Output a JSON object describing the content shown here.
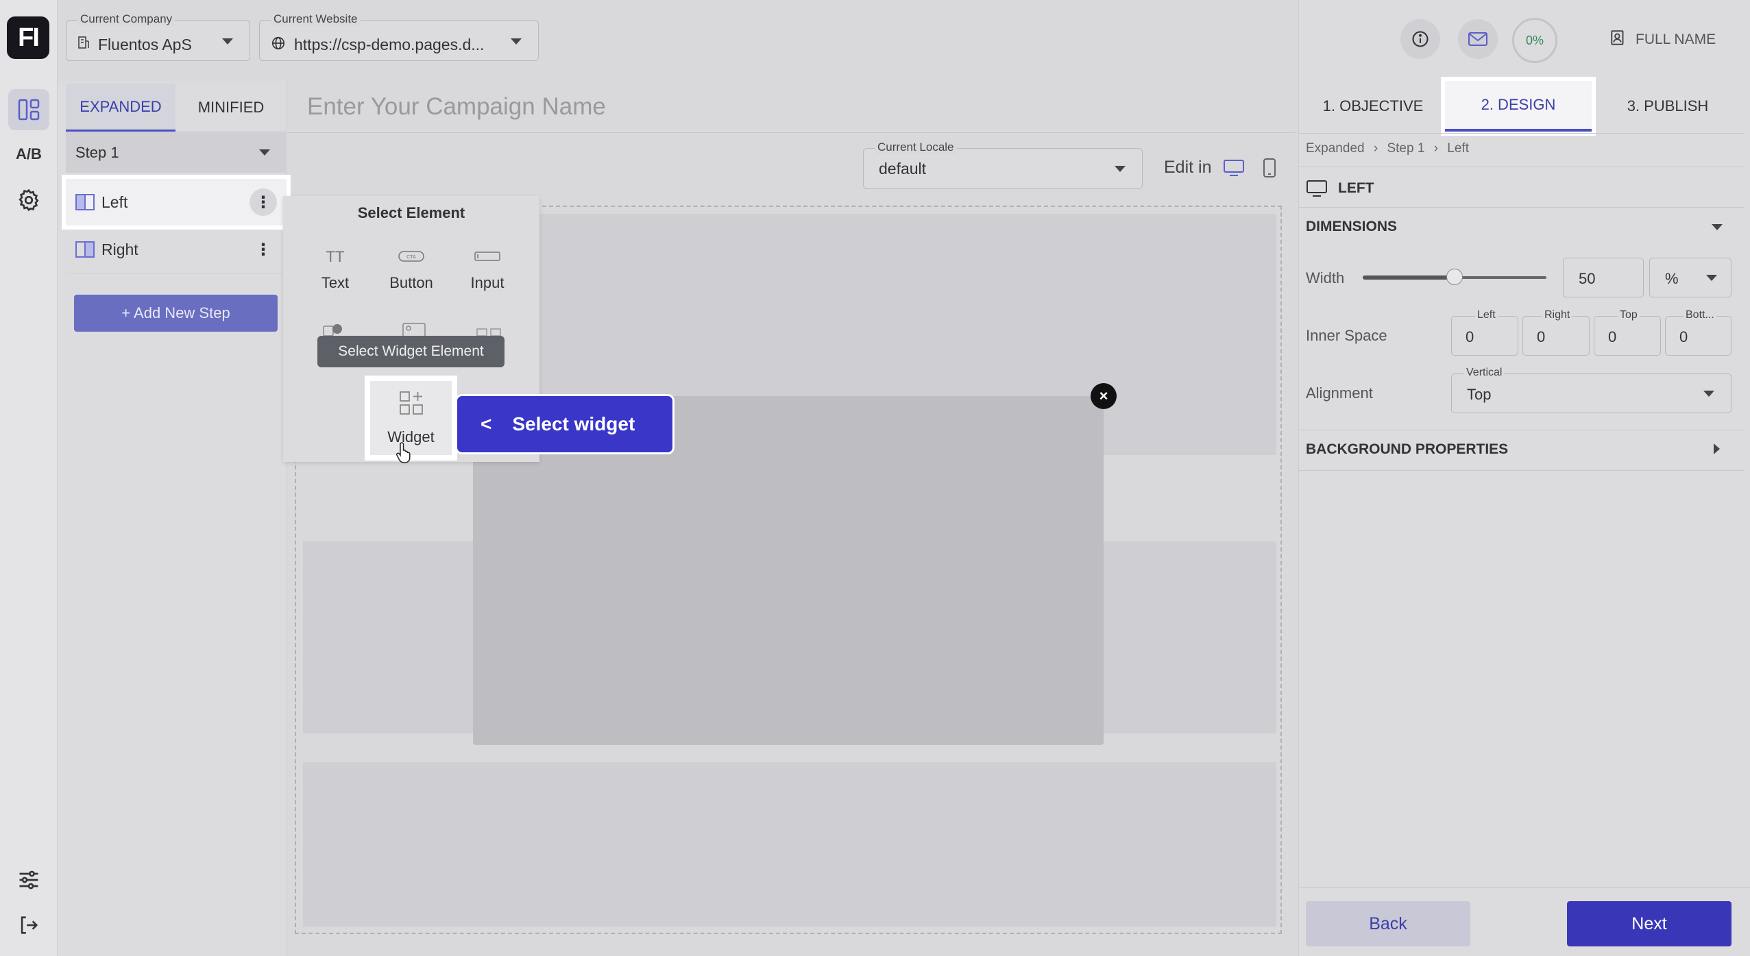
{
  "app": {
    "logo_text": "FI"
  },
  "rail": {
    "items": [
      {
        "icon": "layout-icon",
        "active": true
      },
      {
        "label": "A/B",
        "icon": "ab-test-icon"
      },
      {
        "icon": "gear-icon"
      },
      {
        "icon": "sliders-icon"
      },
      {
        "icon": "logout-icon"
      }
    ]
  },
  "header": {
    "company": {
      "label": "Current Company",
      "value": "Fluentos ApS"
    },
    "website": {
      "label": "Current Website",
      "value": "https://csp-demo.pages.d..."
    },
    "progress": "0%",
    "user_name": "FULL NAME"
  },
  "steps": {
    "tabs": [
      {
        "label": "EXPANDED",
        "active": true
      },
      {
        "label": "MINIFIED",
        "active": false
      }
    ],
    "selected_step": "Step 1",
    "items": [
      {
        "label": "Left",
        "highlighted": true
      },
      {
        "label": "Right",
        "highlighted": false
      }
    ],
    "add_label": "+ Add New Step"
  },
  "campaign": {
    "placeholder": "Enter Your Campaign Name"
  },
  "locale": {
    "label": "Current Locale",
    "value": "default",
    "edit_in": "Edit in"
  },
  "select_element": {
    "title": "Select Element",
    "items": [
      {
        "label": "Text",
        "icon": "text-icon"
      },
      {
        "label": "Button",
        "icon": "cta-button-icon"
      },
      {
        "label": "Input",
        "icon": "input-icon"
      }
    ],
    "tooltip": "Select Widget Element",
    "widget_label": "Widget",
    "callout": "Select widget",
    "callout_prefix": "<",
    "close": "×"
  },
  "design_panel": {
    "tabs": [
      {
        "label": "1. OBJECTIVE",
        "active": false
      },
      {
        "label": "2. DESIGN",
        "active": true
      },
      {
        "label": "3. PUBLISH",
        "active": false
      }
    ],
    "breadcrumb": [
      "Expanded",
      "Step 1",
      "Left"
    ],
    "section_title": "LEFT",
    "dimensions": {
      "title": "DIMENSIONS",
      "width_label": "Width",
      "width_value": "50",
      "width_fraction": 0.5,
      "width_unit": "%",
      "inner_space_label": "Inner Space",
      "inner_space": [
        {
          "label": "Left",
          "value": "0"
        },
        {
          "label": "Right",
          "value": "0"
        },
        {
          "label": "Top",
          "value": "0"
        },
        {
          "label": "Bott...",
          "value": "0"
        }
      ],
      "alignment_label": "Alignment",
      "alignment_field_label": "Vertical",
      "alignment_value": "Top"
    },
    "background_title": "BACKGROUND PROPERTIES",
    "back_label": "Back",
    "next_label": "Next"
  },
  "colors": {
    "accent": "#3936c8",
    "tab_accent": "#4a4fc0",
    "progress_text": "#2e8b57"
  }
}
